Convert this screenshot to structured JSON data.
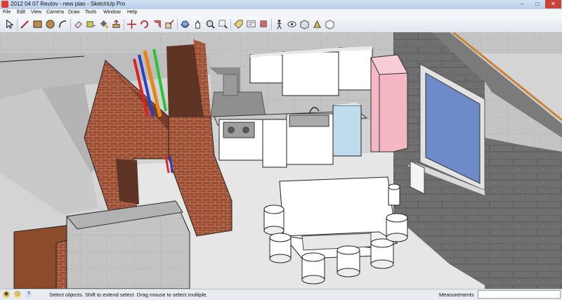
{
  "window": {
    "title": "2012 04 07 Reutov - new plan - SketchUp Pro",
    "controls": [
      "–",
      "□",
      "✕"
    ]
  },
  "menu": [
    "File",
    "Edit",
    "View",
    "Camera",
    "Draw",
    "Tools",
    "Window",
    "Help"
  ],
  "toolbar": {
    "tools": [
      "select",
      "line",
      "rectangle",
      "circle",
      "arc",
      "eraser",
      "tape-measure",
      "paint-bucket",
      "push-pull",
      "move",
      "rotate",
      "offset",
      "orbit",
      "pan",
      "zoom",
      "zoom-extents",
      "dimension",
      "protractor",
      "text",
      "3d-text",
      "section-plane",
      "walk",
      "look-around",
      "position-camera",
      "components",
      "materials",
      "styles",
      "layers"
    ]
  },
  "status": {
    "icons": [
      "geo-location-icon",
      "credits-icon",
      "help-icon"
    ],
    "message": "Select objects. Shift to extend select. Drag mouse to select multiple.",
    "measurements_label": "Measurements",
    "measurements_value": ""
  },
  "scene": {
    "colors": {
      "concrete": "#c4c4c4",
      "dark_block": "#6f6f6f",
      "brick": "#9a4d33",
      "cabinet_white": "#ffffff",
      "fridge_pink": "#f5b7c4",
      "cabinet_blue": "#bfdced",
      "window_blue": "#6e8bc9",
      "floor": "#e6e6e6"
    },
    "pipes": [
      "red",
      "blue",
      "orange",
      "green"
    ]
  }
}
